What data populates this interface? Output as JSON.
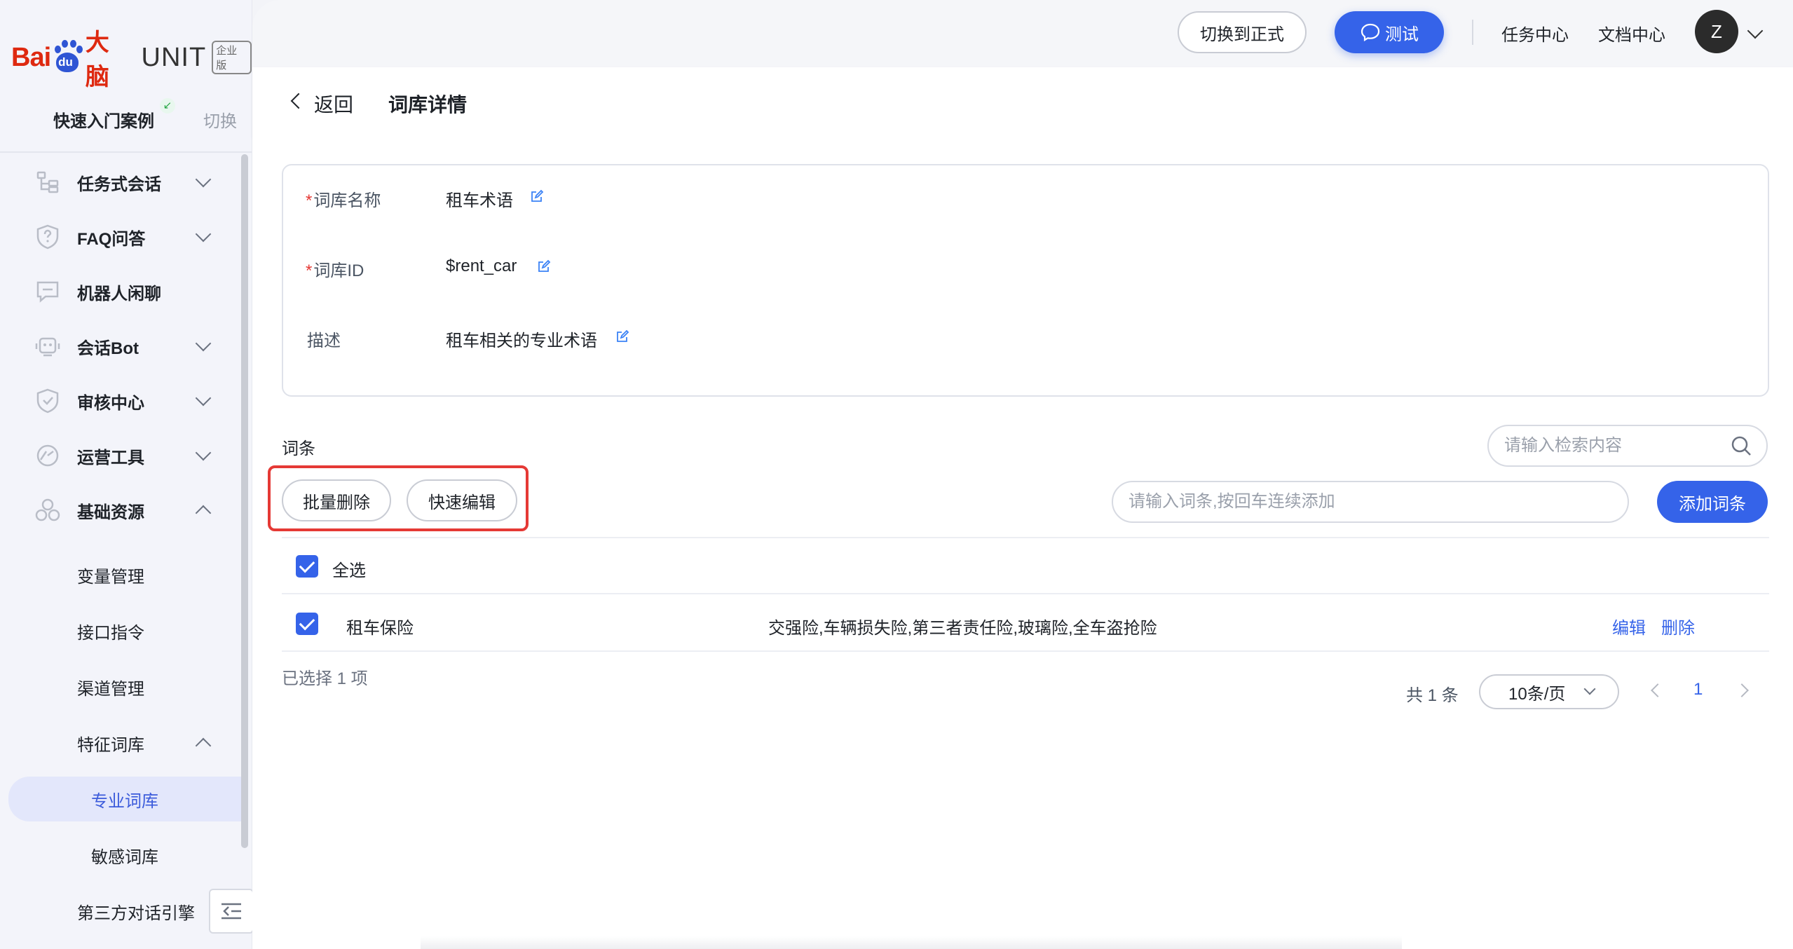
{
  "brand": {
    "logo_text": "Bai",
    "logo_du": "du",
    "logo_cn": "大脑",
    "product": "UNIT",
    "edition": "企业版"
  },
  "workspace": {
    "title": "快速入门案例",
    "switch_label": "切换",
    "flag": "↙"
  },
  "sidebar": {
    "items": [
      {
        "label": "任务式会话",
        "icon": "flow-icon",
        "chevron": "down"
      },
      {
        "label": "FAQ问答",
        "icon": "question-shield-icon",
        "chevron": "down"
      },
      {
        "label": "机器人闲聊",
        "icon": "chat-bubble-icon",
        "chevron": ""
      },
      {
        "label": "会话Bot",
        "icon": "robot-icon",
        "chevron": "down"
      },
      {
        "label": "审核中心",
        "icon": "shield-check-icon",
        "chevron": "down"
      },
      {
        "label": "运营工具",
        "icon": "dashboard-icon",
        "chevron": "down"
      },
      {
        "label": "基础资源",
        "icon": "cubes-icon",
        "chevron": "up"
      }
    ],
    "sub_items": [
      "变量管理",
      "接口指令",
      "渠道管理",
      "特征词库"
    ],
    "lexicon_children": [
      "专业词库",
      "敏感词库"
    ],
    "last_item": "第三方对话引擎",
    "active": "专业词库"
  },
  "topbar": {
    "switch_prod": "切换到正式",
    "test": "测试",
    "task_center": "任务中心",
    "doc_center": "文档中心",
    "avatar_initial": "Z"
  },
  "page": {
    "back": "返回",
    "title": "词库详情"
  },
  "details": {
    "name_label": "词库名称",
    "name_value": "租车术语",
    "id_label": "词库ID",
    "id_value": "$rent_car",
    "desc_label": "描述",
    "desc_value": "租车相关的专业术语"
  },
  "entries": {
    "section_title": "词条",
    "search_placeholder": "请输入检索内容",
    "batch_delete": "批量删除",
    "quick_edit": "快速编辑",
    "add_placeholder": "请输入词条,按回车连续添加",
    "add_button": "添加词条",
    "select_all": "全选",
    "rows": [
      {
        "term": "租车保险",
        "synonyms": "交强险,车辆损失险,第三者责任险,玻璃险,全车盗抢险",
        "edit": "编辑",
        "delete": "删除",
        "checked": true
      }
    ],
    "selected_text": "已选择 1 项",
    "total_text": "共 1 条",
    "page_size": "10条/页",
    "current_page": "1"
  },
  "colors": {
    "primary": "#3563e9",
    "danger": "#e53935",
    "brand_red": "#de2910",
    "brand_blue": "#2f55d4"
  }
}
